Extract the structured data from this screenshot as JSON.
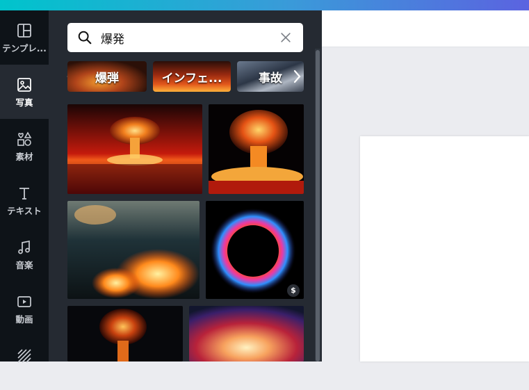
{
  "sidebar": {
    "items": [
      {
        "label": "テンプレ...",
        "icon": "layout-icon"
      },
      {
        "label": "写真",
        "icon": "photo-icon"
      },
      {
        "label": "素材",
        "icon": "shapes-icon"
      },
      {
        "label": "テキスト",
        "icon": "text-icon"
      },
      {
        "label": "音楽",
        "icon": "music-icon"
      },
      {
        "label": "動画",
        "icon": "video-icon"
      },
      {
        "label": "",
        "icon": "background-icon"
      }
    ],
    "active_index": 1
  },
  "search": {
    "value": "爆発"
  },
  "suggestions": [
    {
      "label": "爆弾"
    },
    {
      "label": "インフェ..."
    },
    {
      "label": "事故"
    }
  ],
  "results": [
    {
      "name": "nuclear-explosion-ocean"
    },
    {
      "name": "mushroom-cloud-fire"
    },
    {
      "name": "fire-sparks-ground"
    },
    {
      "name": "colorful-powder-ring",
      "badge": "$"
    },
    {
      "name": "mushroom-cloud-dark"
    },
    {
      "name": "color-burst"
    }
  ],
  "colors": {
    "brand_gradient_start": "#00c4cc",
    "brand_gradient_end": "#5b63e0",
    "rail_bg": "#0e1318",
    "panel_bg": "#252a32"
  }
}
